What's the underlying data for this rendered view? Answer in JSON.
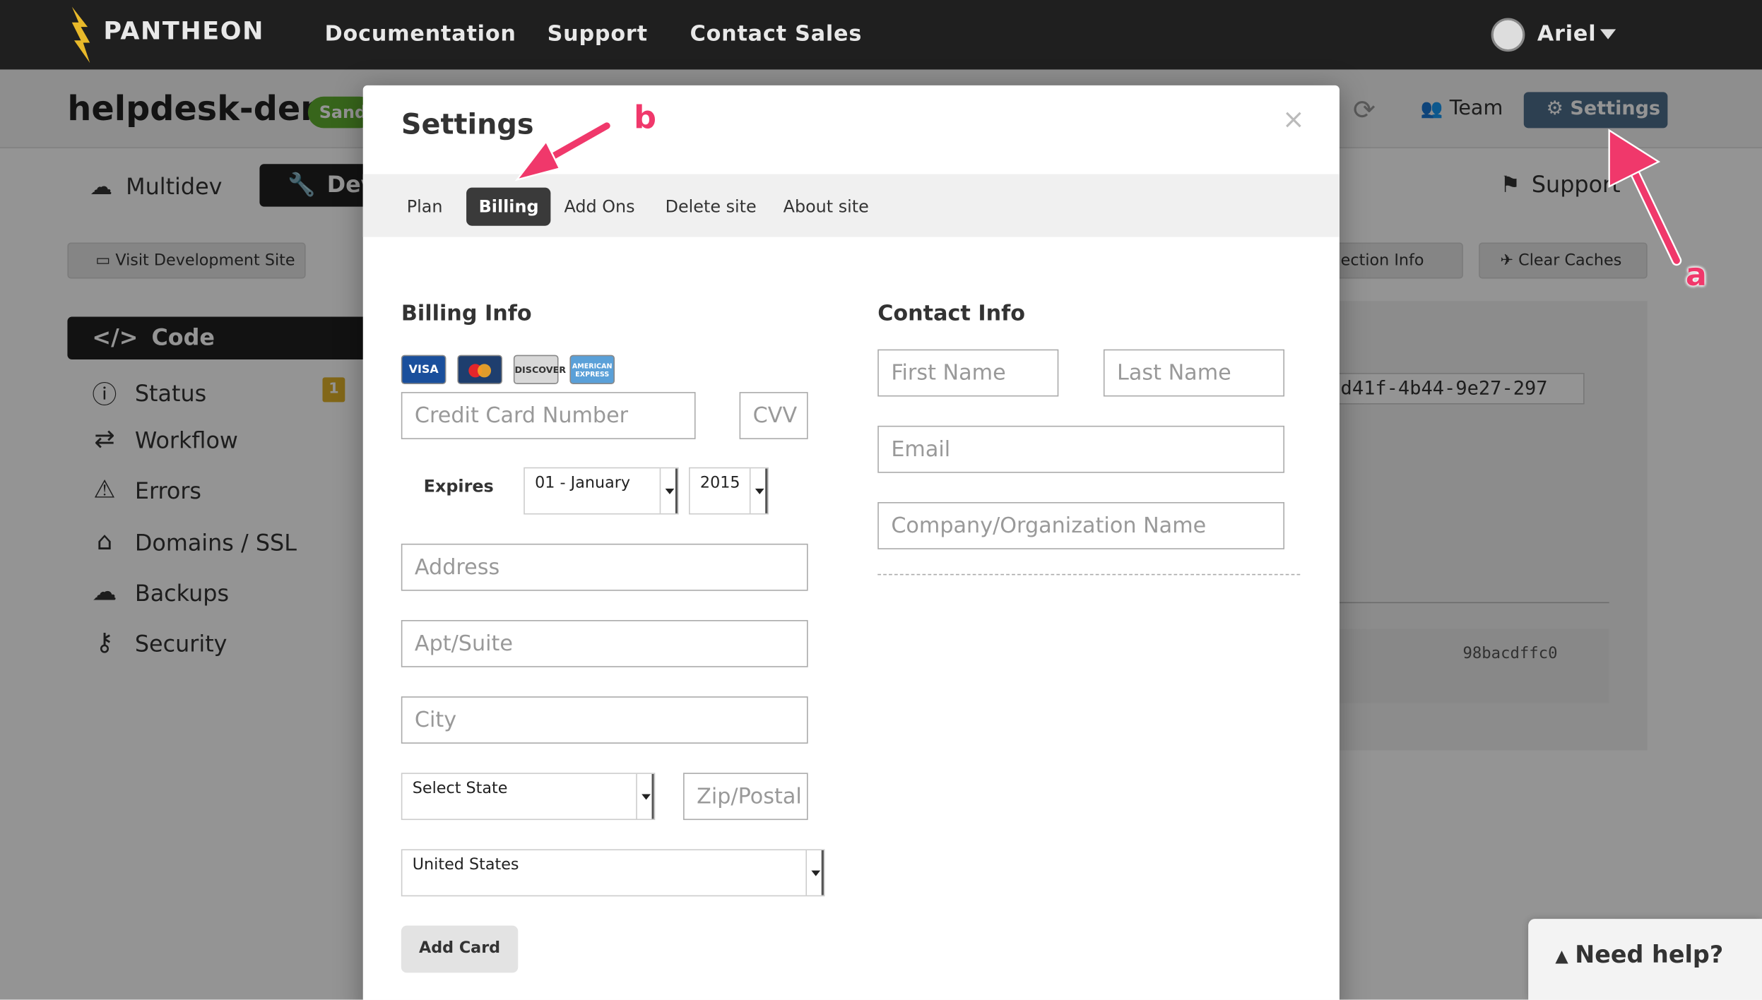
{
  "topnav": {
    "brand": "PANTHEON",
    "links": [
      "Documentation",
      "Support",
      "Contact Sales"
    ],
    "user": "Ariel"
  },
  "site": {
    "name": "helpdesk-demo",
    "badge": "Sandbox",
    "actions": {
      "team": "Team",
      "settings": "Settings"
    }
  },
  "env_tabs": {
    "multidev": "Multidev",
    "dev": "Dev",
    "support": "Support"
  },
  "toolbar": {
    "visit": "Visit Development Site",
    "connection": "Connection Info",
    "clear_caches": "Clear Caches"
  },
  "sidebar": {
    "items": [
      {
        "label": "Code",
        "icon": "code-icon"
      },
      {
        "label": "Status",
        "icon": "info-icon",
        "badge": "1"
      },
      {
        "label": "Workflow",
        "icon": "workflow-icon"
      },
      {
        "label": "Errors",
        "icon": "warning-icon"
      },
      {
        "label": "Domains / SSL",
        "icon": "home-icon"
      },
      {
        "label": "Backups",
        "icon": "cloud-icon"
      },
      {
        "label": "Security",
        "icon": "key-icon"
      }
    ]
  },
  "background": {
    "uuid_fragment": "d41f-4b44-9e27-297",
    "commit": "98bacdffc0"
  },
  "modal": {
    "title": "Settings",
    "close": "×",
    "tabs": [
      "Plan",
      "Billing",
      "Add Ons",
      "Delete site",
      "About site"
    ],
    "active_tab": "Billing",
    "billing": {
      "title": "Billing Info",
      "cards": [
        "VISA",
        "MasterCard",
        "DISCOVER",
        "AMERICAN EXPRESS"
      ],
      "card_placeholder": "Credit Card Number",
      "cvv_placeholder": "CVV",
      "expires_label": "Expires",
      "month": "01 - January",
      "year": "2015",
      "address_placeholder": "Address",
      "apt_placeholder": "Apt/Suite",
      "city_placeholder": "City",
      "state": "Select State",
      "zip_placeholder": "Zip/Postal",
      "country": "United States",
      "add_card": "Add Card"
    },
    "contact": {
      "title": "Contact Info",
      "first_placeholder": "First Name",
      "last_placeholder": "Last Name",
      "email_placeholder": "Email",
      "company_placeholder": "Company/Organization Name"
    }
  },
  "help": {
    "label": "Need help?"
  },
  "annotations": {
    "a": "a",
    "b": "b"
  },
  "colors": {
    "accent": "#f0386b",
    "sandbox": "#5fae2f",
    "settings_btn": "#4f6e8c"
  }
}
